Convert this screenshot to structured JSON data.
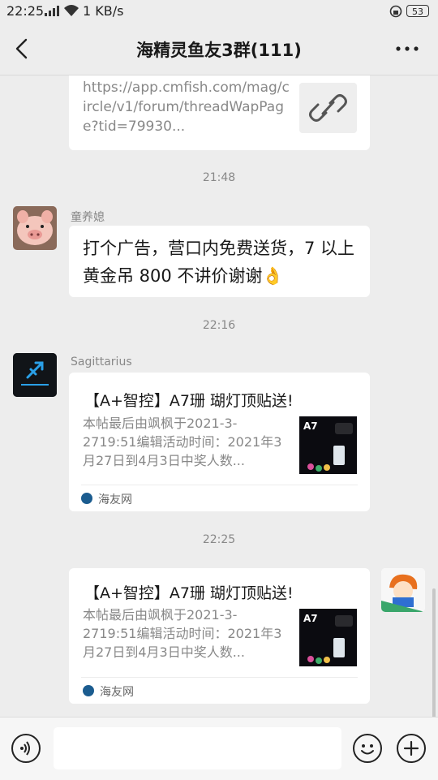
{
  "status_bar": {
    "time": "22:25",
    "network": "KB/s",
    "speed": "1 KB/s",
    "battery": "53"
  },
  "header": {
    "title": "海精灵鱼友3群(111)"
  },
  "messages": {
    "link_card": {
      "url": "https://app.cmfish.com/mag/circle/v1/forum/threadWapPage?tid=79930..."
    },
    "ts1": "21:48",
    "msg1": {
      "sender": "童养媳",
      "text": "打个广告，营口内免费送货，7 以上黄金吊 800 不讲价谢谢👌"
    },
    "ts2": "22:16",
    "msg2": {
      "sender": "Sagittarius",
      "card_title": "【A+智控】A7珊 瑚灯顶贴送!",
      "card_desc": "本帖最后由飒枫于2021-3-2719:51编辑活动时间：2021年3月27日到4月3日中奖人数...",
      "card_source": "海友网",
      "thumb_label": "A7"
    },
    "ts3": "22:25",
    "msg3": {
      "card_title": "【A+智控】A7珊 瑚灯顶贴送!",
      "card_desc": "本帖最后由飒枫于2021-3-2719:51编辑活动时间：2021年3月27日到4月3日中奖人数...",
      "card_source": "海友网",
      "thumb_label": "A7"
    }
  },
  "colors": {
    "bg": "#ededed",
    "bubble": "#ffffff",
    "meta_text": "#888888",
    "source_icon": "#1b5c8f"
  },
  "icons": {
    "back": "back-arrow-icon",
    "more": "more-icon",
    "link": "link-icon",
    "voice": "voice-icon",
    "emoji": "emoji-icon",
    "plus": "plus-icon"
  }
}
